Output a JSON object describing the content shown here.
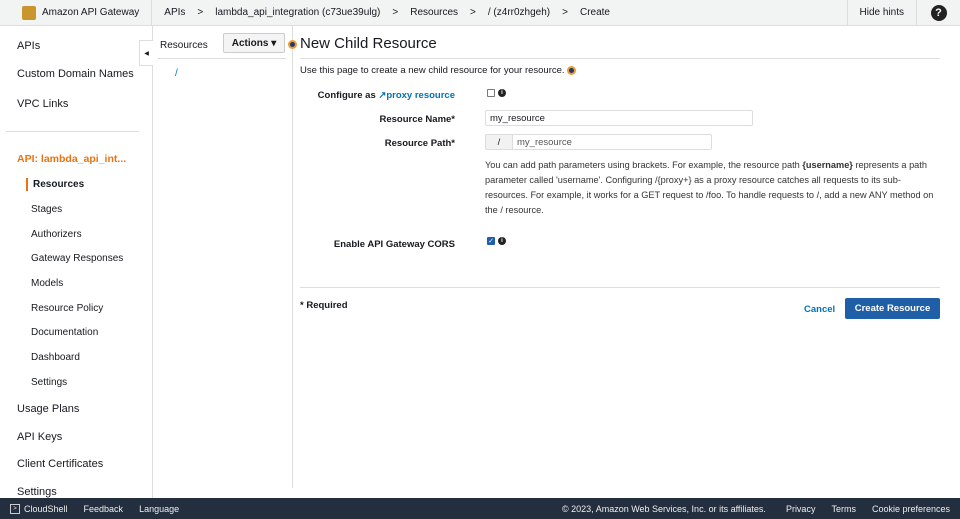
{
  "header": {
    "brand": "Amazon API Gateway",
    "breadcrumbs": [
      "APIs",
      ">",
      "lambda_api_integration (c73ue39ulg)",
      ">",
      "Resources",
      ">",
      "/ (z4rr0zhgeh)",
      ">",
      "Create"
    ],
    "hide_hints": "Hide hints"
  },
  "sidebar": {
    "top": [
      "APIs",
      "Custom Domain Names",
      "VPC Links"
    ],
    "api": "API: lambda_api_int...",
    "sub": [
      "Resources",
      "Stages",
      "Authorizers",
      "Gateway Responses",
      "Models",
      "Resource Policy",
      "Documentation",
      "Dashboard",
      "Settings"
    ],
    "bottom": [
      "Usage Plans",
      "API Keys",
      "Client Certificates",
      "Settings"
    ]
  },
  "tree": {
    "title": "Resources",
    "actions": "Actions ▾",
    "root": "/"
  },
  "form": {
    "title": "New Child Resource",
    "intro": "Use this page to create a new child resource for your resource.",
    "proxy_prefix": "Configure as",
    "proxy_link": "proxy resource",
    "name_label": "Resource Name*",
    "name_value": "my_resource",
    "path_label": "Resource Path*",
    "path_prefix": "/",
    "path_value": "my_resource",
    "help_1": "You can add path parameters using brackets. For example, the resource path ",
    "help_bold": "{username}",
    "help_2": " represents a path parameter called 'username'. Configuring /{proxy+} as a proxy resource catches all requests to its sub-resources. For example, it works for a GET request to /foo. To handle requests to /, add a new ANY method on the / resource.",
    "cors_label": "Enable API Gateway CORS",
    "proxy_checked": false,
    "cors_checked": true,
    "required": "* Required",
    "cancel": "Cancel",
    "create": "Create Resource"
  },
  "footer": {
    "cloudshell": "CloudShell",
    "feedback": "Feedback",
    "language": "Language",
    "copyright": "© 2023, Amazon Web Services, Inc. or its affiliates.",
    "privacy": "Privacy",
    "terms": "Terms",
    "cookies": "Cookie preferences"
  },
  "colors": {
    "accent": "#ec7211",
    "link": "#0073bb",
    "primary_button": "#1f5fa8",
    "footer_bg": "#232f3e"
  }
}
